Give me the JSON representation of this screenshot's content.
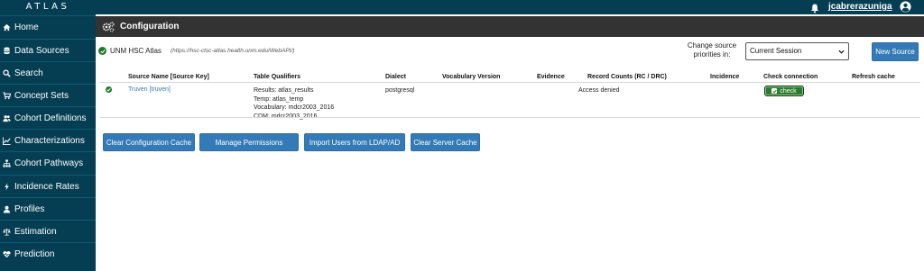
{
  "app": {
    "brand": "ATLAS",
    "user": "jcabrerazuniga"
  },
  "nav": [
    {
      "label": "Home",
      "icon": "home-icon"
    },
    {
      "label": "Data Sources",
      "icon": "database-icon"
    },
    {
      "label": "Search",
      "icon": "search-icon"
    },
    {
      "label": "Concept Sets",
      "icon": "cart-icon"
    },
    {
      "label": "Cohort Definitions",
      "icon": "users-icon"
    },
    {
      "label": "Characterizations",
      "icon": "line-chart-icon"
    },
    {
      "label": "Cohort Pathways",
      "icon": "sitemap-icon"
    },
    {
      "label": "Incidence Rates",
      "icon": "bolt-icon"
    },
    {
      "label": "Profiles",
      "icon": "user-icon"
    },
    {
      "label": "Estimation",
      "icon": "balance-scale-icon"
    },
    {
      "label": "Prediction",
      "icon": "heartbeat-icon"
    }
  ],
  "header": {
    "title": "Configuration"
  },
  "source": {
    "name": "UNM HSC Atlas",
    "url": "(https://hsc-ctsc-atlas.health.unm.edu/WebAPI/)"
  },
  "priority": {
    "label": "Change source priorities in:",
    "selected": "Current Session"
  },
  "buttons": {
    "new_source": "New Source",
    "clear_config_cache": "Clear Configuration Cache",
    "manage_permissions": "Manage Permissions",
    "import_users": "Import Users from LDAP/AD",
    "clear_server_cache": "Clear Server Cache"
  },
  "table": {
    "columns": [
      "Source Name [Source Key]",
      "Table Qualifiers",
      "Dialect",
      "Vocabulary Version",
      "Evidence",
      "Record Counts (RC / DRC)",
      "Incidence",
      "Check connection",
      "Refresh cache"
    ],
    "rows": [
      {
        "source_name": "Truven [truven]",
        "qualifiers": [
          "Results: atlas_results",
          "Temp: atlas_temp",
          "Vocabulary: mdcr2003_2016",
          "CDM: mdcr2003_2016"
        ],
        "dialect": "postgresql",
        "vocabulary_version": "",
        "evidence": "",
        "record_counts": "Access denied",
        "incidence": "",
        "check_label": "check",
        "refresh_cache": ""
      }
    ]
  },
  "colors": {
    "sidebar": "#053e53",
    "header": "#333333",
    "primary": "#337ab7",
    "success": "#2a7d2e"
  }
}
